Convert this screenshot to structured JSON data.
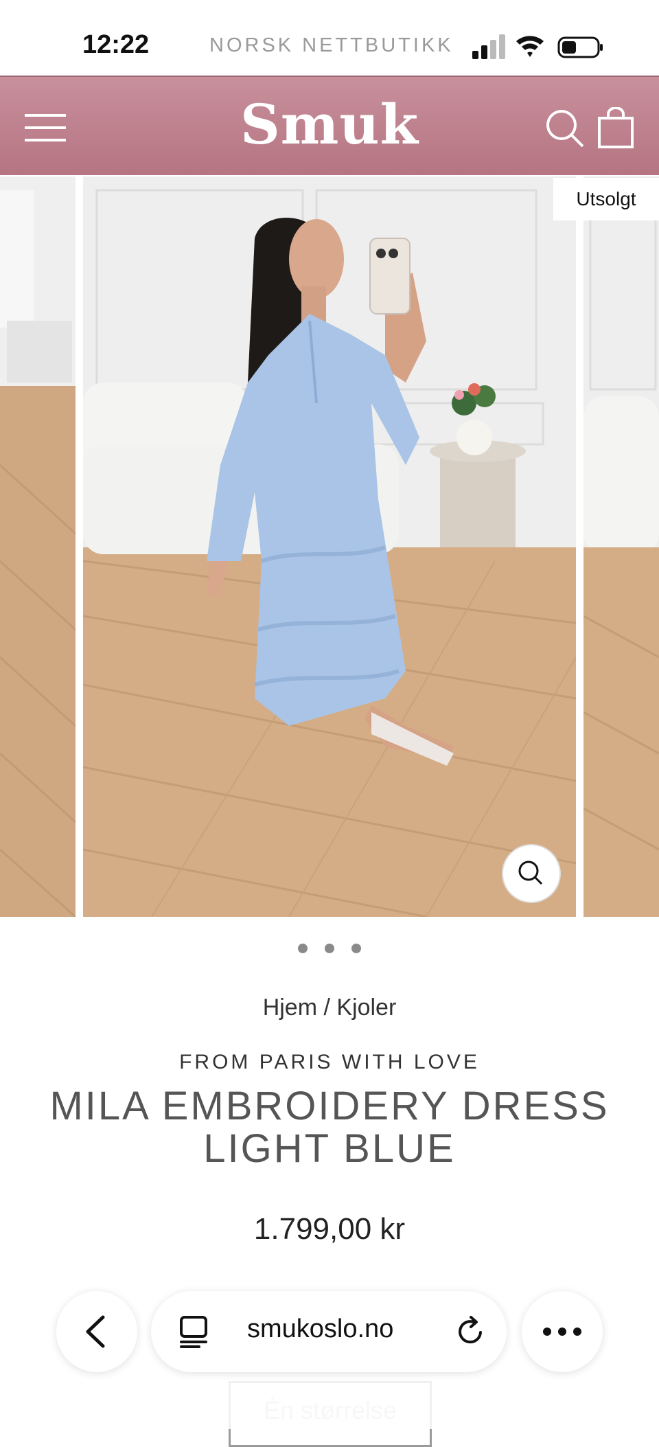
{
  "status_bar": {
    "time": "12:22",
    "carrier": "NORSK NETTBUTIKK"
  },
  "header": {
    "logo": "Smuk"
  },
  "gallery": {
    "badge": "Utsolgt",
    "dot_count": 3
  },
  "product": {
    "breadcrumb": "Hjem / Kjoler",
    "brand": "FROM PARIS WITH LOVE",
    "title": "MILA EMBROIDERY DRESS LIGHT BLUE",
    "price": "1.799,00 kr"
  },
  "size_button": {
    "label": "Én størrelse"
  },
  "browser": {
    "url": "smukoslo.no"
  },
  "colors": {
    "header": "#b57481",
    "dress": "#a9c4e6",
    "floor": "#cfa882"
  },
  "icons": [
    "menu-icon",
    "search-icon",
    "bag-icon",
    "zoom-icon",
    "back-icon",
    "tabs-icon",
    "reload-icon",
    "more-icon"
  ]
}
